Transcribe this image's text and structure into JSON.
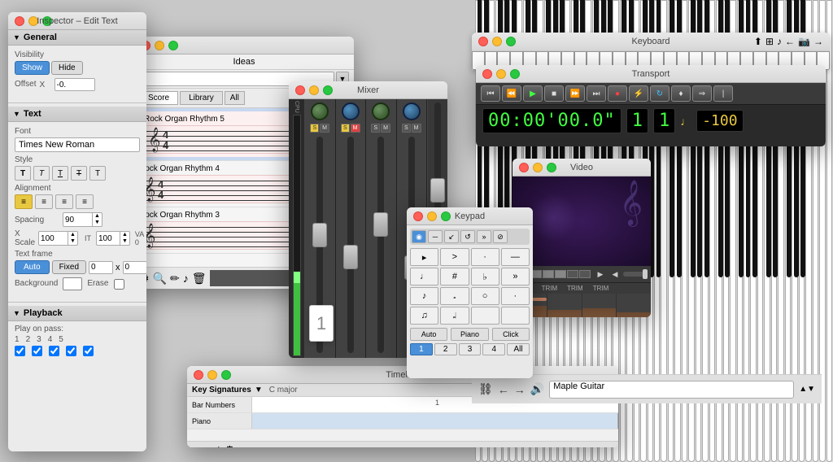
{
  "inspector": {
    "title": "Inspector – Edit Text",
    "general": {
      "label": "General",
      "visibility_label": "Visibility",
      "show_label": "Show",
      "hide_label": "Hide",
      "offset_label": "Offset",
      "x_label": "X",
      "x_value": "-0."
    },
    "text": {
      "label": "Text",
      "font_label": "Font",
      "font_name": "Times New Roman",
      "style_label": "Style",
      "alignment_label": "Alignment",
      "spacing_label": "Spacing",
      "spacing_value": "90",
      "xscale_label": "X Scale",
      "xscale_value": "100",
      "it_value": "100",
      "textframe_label": "Text frame",
      "auto_label": "Auto",
      "fixed_label": "Fixed",
      "fixed_val1": "0",
      "fixed_val2": "0",
      "background_label": "Background",
      "erase_label": "Erase"
    },
    "playback": {
      "label": "Playback",
      "play_on_pass": "Play on pass:",
      "passes": [
        "1",
        "2",
        "3",
        "4",
        "5"
      ],
      "checked": [
        true,
        true,
        true,
        true,
        true
      ]
    }
  },
  "ideas": {
    "title": "",
    "label": "Ideas",
    "tabs": [
      "Score",
      "Library",
      "All"
    ],
    "items": [
      {
        "title": "Rock Organ Rhythm 5",
        "detail": "4/4"
      },
      {
        "title": "Rock Organ Rhythm 4",
        "detail": "4/4"
      },
      {
        "title": "Rock Organ Rhythm 3",
        "detail": ""
      }
    ]
  },
  "mixer": {
    "label": "Mixer"
  },
  "transport": {
    "title": "Transport",
    "time": "00:00'00.0\"",
    "bar": "1",
    "beat": "1",
    "tempo_icon": "♩",
    "tempo": "-100"
  },
  "keyboard": {
    "title": "Keyboard"
  },
  "keypad": {
    "title": "Keypad",
    "tools": [
      "◉",
      "─",
      "↙",
      "↺",
      "»"
    ],
    "row1": [
      "▸",
      ">",
      "·",
      "─"
    ],
    "row2": [
      "♩",
      "#",
      "♭",
      "»"
    ],
    "row3": [
      "♪",
      "𝅗",
      "○",
      "·"
    ],
    "row4": [
      "♫",
      "𝆷",
      "",
      ""
    ],
    "bottom": [
      "Auto",
      "Piano",
      "Click"
    ]
  },
  "video": {
    "title": "Video"
  },
  "timeline": {
    "title": "Timeline",
    "key_sig": "Key Signatures",
    "key_val": "C major",
    "bar_numbers": "Bar Numbers",
    "bar_val": "1",
    "track_label": "Piano"
  },
  "bottom_bar": {
    "instrument": "Maple Guitar"
  },
  "score_notation": {
    "items": [
      {
        "name": "Rock Organ Rhythm 5",
        "time_sig": "4/4"
      },
      {
        "name": "Rock Organ Rhythm 4",
        "time_sig": "4/4"
      },
      {
        "name": "Rock Organ Rhythm 3",
        "time_sig": ""
      }
    ]
  }
}
